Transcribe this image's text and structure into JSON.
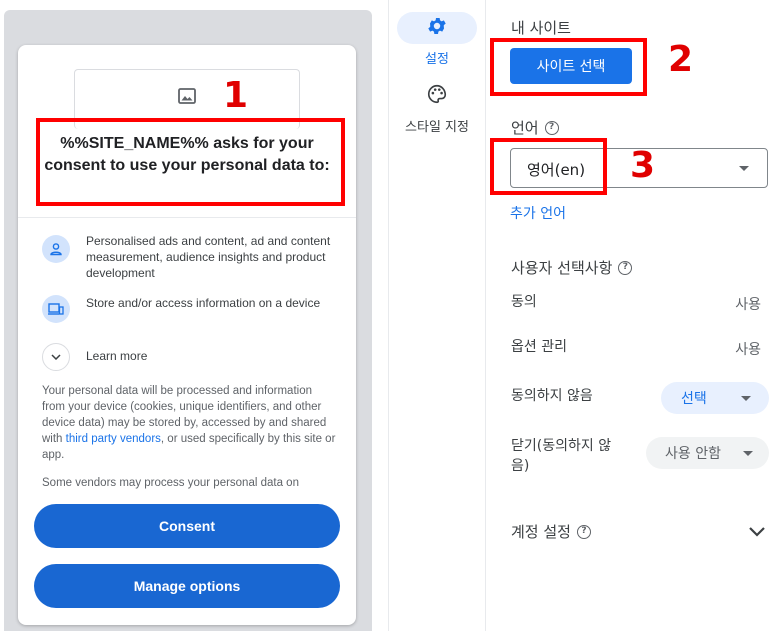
{
  "preview": {
    "title": "%%SITE_NAME%% asks for your consent to use your personal data to:",
    "purposes": [
      {
        "icon": "person-icon",
        "text": "Personalised ads and content, ad and content measurement, audience insights and product development"
      },
      {
        "icon": "devices-icon",
        "text": "Store and/or access information on a device"
      }
    ],
    "learn_more": "Learn more",
    "body_before_link": "Your personal data will be processed and information from your device (cookies, unique identifiers, and other device data) may be stored by, accessed by and shared with ",
    "body_link": "third party vendors",
    "body_after_link": ", or used specifically by this site or app.",
    "body_more": "Some vendors may process your personal data on",
    "consent_button": "Consent",
    "manage_button": "Manage options"
  },
  "nav": {
    "items": [
      {
        "icon": "gear-icon",
        "label": "설정",
        "active": true
      },
      {
        "icon": "palette-icon",
        "label": "스타일 지정",
        "active": false
      }
    ]
  },
  "settings": {
    "my_site_label": "내 사이트",
    "select_site_button": "사이트 선택",
    "language_label": "언어",
    "language_value": "영어(en)",
    "add_language": "추가 언어",
    "user_choices_label": "사용자 선택사항",
    "rows": [
      {
        "label": "동의",
        "value": "사용"
      },
      {
        "label": "옵션 관리",
        "value": "사용"
      }
    ],
    "do_not_consent_label": "동의하지 않음",
    "do_not_consent_value": "선택",
    "close_label": "닫기(동의하지 않음)",
    "close_label_line1": "닫기(동의하지 않",
    "close_label_line2": "음)",
    "close_value": "사용 안함",
    "account_settings_label": "계정 설정"
  },
  "annotations": [
    "1",
    "2",
    "3"
  ],
  "colors": {
    "accent": "#1a73e8",
    "button_dark": "#1967d2",
    "annotation_red": "#ff0000",
    "chip_selected_bg": "#e8f0fe",
    "chip_default_bg": "#f1f3f4"
  }
}
